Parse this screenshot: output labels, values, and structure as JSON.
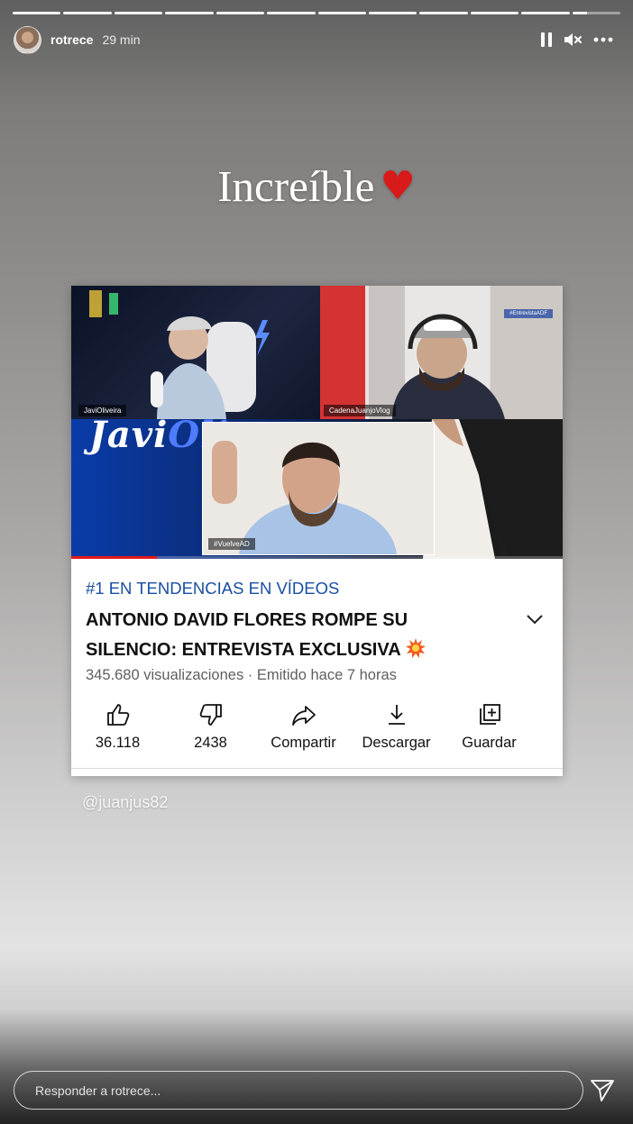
{
  "story": {
    "username": "rotrece",
    "time": "29 min",
    "segments_total": 12,
    "segments_completed": 11,
    "current_segment_progress": 0.3
  },
  "header_icons": {
    "pause": "pause-icon",
    "mute": "mute-icon",
    "more": "more-icon"
  },
  "caption": {
    "text": "Increíble",
    "emoji": "♥",
    "emoji_color": "#d81a1a"
  },
  "video_card": {
    "thumbnail": {
      "left_pane_name": "JaviOliveira",
      "right_pane_name": "CadenaJuanjoVlog",
      "center_tag": "#VuelveAD",
      "brand_text_white": "Javi",
      "brand_text_blue": "Olive",
      "corner_hashtag": "#EntrevistaADF"
    },
    "trending": "#1 EN TENDENCIAS EN VÍDEOS",
    "title": "ANTONIO DAVID FLORES ROMPE SU SILENCIO: ENTREVISTA EXCLUSIVA",
    "stats": "345.680 visualizaciones · Emitido hace 7 horas",
    "actions": [
      {
        "icon": "like-icon",
        "label": "36.118"
      },
      {
        "icon": "dislike-icon",
        "label": "2438"
      },
      {
        "icon": "share-icon",
        "label": "Compartir"
      },
      {
        "icon": "download-icon",
        "label": "Descargar"
      },
      {
        "icon": "save-playlist-icon",
        "label": "Guardar"
      }
    ],
    "trending_color": "#1a4ea2"
  },
  "mention": "@juanjus82",
  "reply": {
    "placeholder": "Responder a rotrece..."
  }
}
